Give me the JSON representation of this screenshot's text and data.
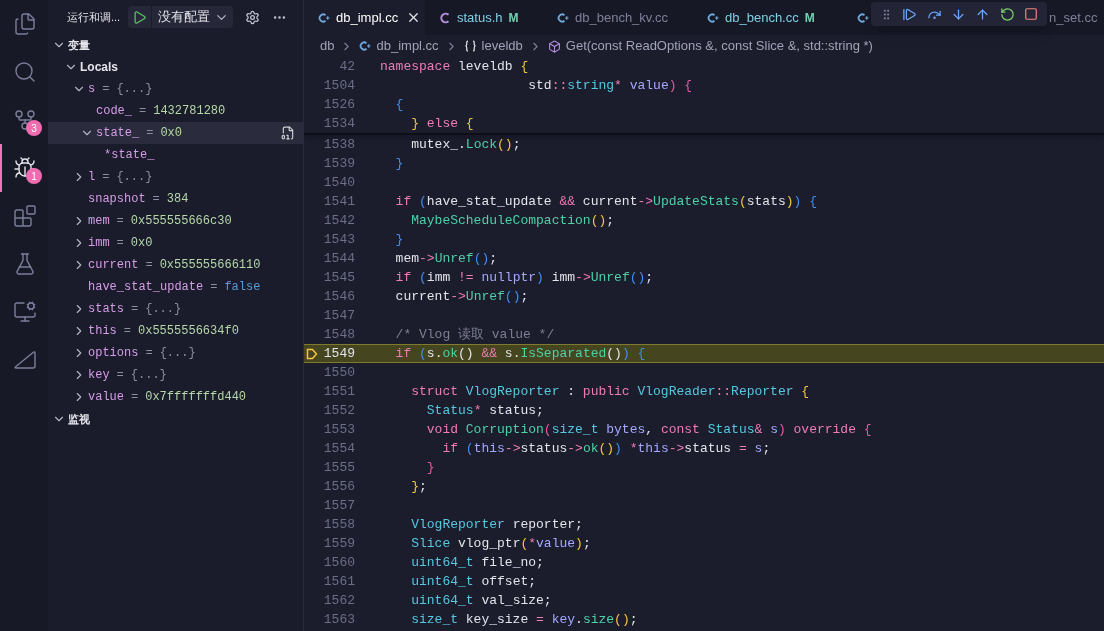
{
  "activity_bar": [
    {
      "selected": false
    },
    {
      "selected": false
    },
    {
      "selected": false,
      "badge": "3"
    },
    {
      "selected": true,
      "badge": "1"
    },
    {
      "selected": false
    },
    {
      "selected": false
    },
    {
      "selected": false
    },
    {
      "selected": false
    }
  ],
  "sidebar": {
    "title": "运行和调...",
    "config": "没有配置",
    "sections": [
      {
        "title": "变量",
        "expanded": true,
        "tree": [
          {
            "name": "Locals",
            "kind": "scope",
            "expanded": true,
            "selected": false,
            "children": [
              {
                "name": "s",
                "kind": "object",
                "eq": "=",
                "value": "{...}",
                "expanded": true,
                "selected": false,
                "children": [
                  {
                    "name": "code_",
                    "kind": "number",
                    "eq": "=",
                    "value": "1432781280",
                    "selected": false
                  },
                  {
                    "name": "state_",
                    "kind": "number",
                    "eq": "=",
                    "value": "0x0",
                    "expanded": true,
                    "selected": true,
                    "children": [
                      {
                        "name": "*state_",
                        "selected": false
                      }
                    ]
                  }
                ]
              },
              {
                "name": "l",
                "kind": "object",
                "eq": "=",
                "value": "{...}",
                "expanded": false,
                "selected": false
              },
              {
                "name": "snapshot",
                "kind": "number",
                "eq": "=",
                "value": "384",
                "selected": false
              },
              {
                "name": "mem",
                "kind": "number",
                "eq": "=",
                "value": "0x555555666c30",
                "expanded": false,
                "selected": false
              },
              {
                "name": "imm",
                "kind": "number",
                "eq": "=",
                "value": "0x0",
                "expanded": false,
                "selected": false
              },
              {
                "name": "current",
                "kind": "number",
                "eq": "=",
                "value": "0x555555666110",
                "expanded": false,
                "selected": false
              },
              {
                "name": "have_stat_update",
                "kind": "boolean",
                "eq": "=",
                "value": "false",
                "selected": false
              },
              {
                "name": "stats",
                "kind": "object",
                "eq": "=",
                "value": "{...}",
                "expanded": false,
                "selected": false
              },
              {
                "name": "this",
                "kind": "number",
                "eq": "=",
                "value": "0x5555556634f0",
                "expanded": false,
                "selected": false
              },
              {
                "name": "options",
                "kind": "object",
                "eq": "=",
                "value": "{...}",
                "expanded": false,
                "selected": false
              },
              {
                "name": "key",
                "kind": "object",
                "eq": "=",
                "value": "{...}",
                "expanded": false,
                "selected": false
              },
              {
                "name": "value",
                "kind": "number",
                "eq": "=",
                "value": "0x7fffffffd440",
                "expanded": false,
                "selected": false
              }
            ]
          }
        ]
      },
      {
        "title": "监视",
        "expanded": true
      }
    ]
  },
  "tabs": [
    {
      "label": "db_impl.cc",
      "selected": true
    },
    {
      "label": "status.h",
      "badge": "M",
      "selected": false
    },
    {
      "label": "db_bench_kv.cc",
      "selected": false
    },
    {
      "label": "db_bench.cc",
      "badge": "M",
      "selected": false
    },
    {
      "label": "n_set.cc",
      "selected": false
    }
  ],
  "breadcrumbs": [
    {
      "label": "db"
    },
    {
      "label": "db_impl.cc"
    },
    {
      "label": "leveldb"
    },
    {
      "label": "Get(const ReadOptions &, const Slice &, std::string *)"
    }
  ],
  "sticky_lines": [
    {
      "number": "42",
      "tokens": [
        {
          "kind": "kw",
          "text": "namespace"
        },
        {
          "kind": "plain",
          "text": " leveldb "
        },
        {
          "kind": "br1",
          "text": "{"
        }
      ]
    },
    {
      "number": "1504",
      "tokens": [
        {
          "kind": "plain",
          "text": "                   std"
        },
        {
          "kind": "op",
          "text": "::"
        },
        {
          "kind": "type",
          "text": "string"
        },
        {
          "kind": "op",
          "text": "*"
        },
        {
          "kind": "param",
          "text": " value"
        },
        {
          "kind": "br2",
          "text": ") {"
        }
      ]
    },
    {
      "number": "1526",
      "tokens": [
        {
          "kind": "br3",
          "text": "  {"
        }
      ]
    },
    {
      "number": "1534",
      "tokens": [
        {
          "kind": "br1",
          "text": "    }"
        },
        {
          "kind": "kw",
          "text": " else "
        },
        {
          "kind": "br1",
          "text": "{"
        }
      ]
    }
  ],
  "lines": [
    {
      "number": "1538",
      "current": false,
      "tokens": [
        {
          "kind": "plain",
          "text": "    mutex_."
        },
        {
          "kind": "fn",
          "text": "Lock"
        },
        {
          "kind": "br1",
          "text": "()"
        },
        {
          "kind": "plain",
          "text": ";"
        }
      ]
    },
    {
      "number": "1539",
      "current": false,
      "tokens": [
        {
          "kind": "br3",
          "text": "  }"
        }
      ]
    },
    {
      "number": "1540",
      "current": false
    },
    {
      "number": "1541",
      "current": false,
      "tokens": [
        {
          "kind": "kw",
          "text": "  if"
        },
        {
          "kind": "br3",
          "text": " ("
        },
        {
          "kind": "plain",
          "text": "have_stat_update "
        },
        {
          "kind": "op",
          "text": "&&"
        },
        {
          "kind": "plain",
          "text": " current"
        },
        {
          "kind": "op",
          "text": "->"
        },
        {
          "kind": "fn",
          "text": "UpdateStats"
        },
        {
          "kind": "br1",
          "text": "("
        },
        {
          "kind": "plain",
          "text": "stats"
        },
        {
          "kind": "br1",
          "text": ")"
        },
        {
          "kind": "br3",
          "text": ") {"
        }
      ]
    },
    {
      "number": "1542",
      "current": false,
      "tokens": [
        {
          "kind": "fn",
          "text": "    MaybeScheduleCompaction"
        },
        {
          "kind": "br1",
          "text": "()"
        },
        {
          "kind": "plain",
          "text": ";"
        }
      ]
    },
    {
      "number": "1543",
      "current": false,
      "tokens": [
        {
          "kind": "br3",
          "text": "  }"
        }
      ]
    },
    {
      "number": "1544",
      "current": false,
      "tokens": [
        {
          "kind": "plain",
          "text": "  mem"
        },
        {
          "kind": "op",
          "text": "->"
        },
        {
          "kind": "fn",
          "text": "Unref"
        },
        {
          "kind": "br3",
          "text": "()"
        },
        {
          "kind": "plain",
          "text": ";"
        }
      ]
    },
    {
      "number": "1545",
      "current": false,
      "tokens": [
        {
          "kind": "kw",
          "text": "  if"
        },
        {
          "kind": "br3",
          "text": " ("
        },
        {
          "kind": "plain",
          "text": "imm "
        },
        {
          "kind": "op",
          "text": "!="
        },
        {
          "kind": "param",
          "text": " nullptr"
        },
        {
          "kind": "br3",
          "text": ")"
        },
        {
          "kind": "plain",
          "text": " imm"
        },
        {
          "kind": "op",
          "text": "->"
        },
        {
          "kind": "fn",
          "text": "Unref"
        },
        {
          "kind": "br3",
          "text": "()"
        },
        {
          "kind": "plain",
          "text": ";"
        }
      ]
    },
    {
      "number": "1546",
      "current": false,
      "tokens": [
        {
          "kind": "plain",
          "text": "  current"
        },
        {
          "kind": "op",
          "text": "->"
        },
        {
          "kind": "fn",
          "text": "Unref"
        },
        {
          "kind": "br3",
          "text": "()"
        },
        {
          "kind": "plain",
          "text": ";"
        }
      ]
    },
    {
      "number": "1547",
      "current": false
    },
    {
      "number": "1548",
      "current": false,
      "tokens": [
        {
          "kind": "cm",
          "text": "  /* Vlog 读取 value */"
        }
      ]
    },
    {
      "number": "1549",
      "current": true,
      "tokens": [
        {
          "kind": "kw",
          "text": "  if"
        },
        {
          "kind": "br3",
          "text": " ("
        },
        {
          "kind": "plain",
          "text": "s."
        },
        {
          "kind": "fn",
          "text": "ok"
        },
        {
          "kind": "plain",
          "text": "() "
        },
        {
          "kind": "op",
          "text": "&&"
        },
        {
          "kind": "plain",
          "text": " s."
        },
        {
          "kind": "fn",
          "text": "IsSeparated"
        },
        {
          "kind": "plain",
          "text": "()"
        },
        {
          "kind": "br3",
          "text": ") {"
        }
      ]
    },
    {
      "number": "1550",
      "current": false
    },
    {
      "number": "1551",
      "current": false,
      "tokens": [
        {
          "kind": "kw",
          "text": "    struct"
        },
        {
          "kind": "type",
          "text": " VlogReporter"
        },
        {
          "kind": "plain",
          "text": " : "
        },
        {
          "kind": "kw",
          "text": "public"
        },
        {
          "kind": "type",
          "text": " VlogReader"
        },
        {
          "kind": "op",
          "text": "::"
        },
        {
          "kind": "type",
          "text": "Reporter"
        },
        {
          "kind": "br1",
          "text": " {"
        }
      ]
    },
    {
      "number": "1552",
      "current": false,
      "tokens": [
        {
          "kind": "type",
          "text": "      Status"
        },
        {
          "kind": "op",
          "text": "*"
        },
        {
          "kind": "plain",
          "text": " status;"
        }
      ]
    },
    {
      "number": "1553",
      "current": false,
      "tokens": [
        {
          "kind": "kw",
          "text": "      void"
        },
        {
          "kind": "fn",
          "text": " Corruption"
        },
        {
          "kind": "br2",
          "text": "("
        },
        {
          "kind": "type",
          "text": "size_t"
        },
        {
          "kind": "param",
          "text": " bytes"
        },
        {
          "kind": "plain",
          "text": ", "
        },
        {
          "kind": "kw",
          "text": "const"
        },
        {
          "kind": "type",
          "text": " Status"
        },
        {
          "kind": "op",
          "text": "&"
        },
        {
          "kind": "param",
          "text": " s"
        },
        {
          "kind": "br2",
          "text": ")"
        },
        {
          "kind": "kw",
          "text": " override"
        },
        {
          "kind": "br2",
          "text": " {"
        }
      ]
    },
    {
      "number": "1554",
      "current": false,
      "tokens": [
        {
          "kind": "kw",
          "text": "        if"
        },
        {
          "kind": "br3",
          "text": " ("
        },
        {
          "kind": "param",
          "text": "this"
        },
        {
          "kind": "op",
          "text": "->"
        },
        {
          "kind": "plain",
          "text": "status"
        },
        {
          "kind": "op",
          "text": "->"
        },
        {
          "kind": "fn",
          "text": "ok"
        },
        {
          "kind": "br1",
          "text": "()"
        },
        {
          "kind": "br3",
          "text": ")"
        },
        {
          "kind": "op",
          "text": " *"
        },
        {
          "kind": "param",
          "text": "this"
        },
        {
          "kind": "op",
          "text": "->"
        },
        {
          "kind": "plain",
          "text": "status "
        },
        {
          "kind": "op",
          "text": "="
        },
        {
          "kind": "param",
          "text": " s"
        },
        {
          "kind": "plain",
          "text": ";"
        }
      ]
    },
    {
      "number": "1555",
      "current": false,
      "tokens": [
        {
          "kind": "br2",
          "text": "      }"
        }
      ]
    },
    {
      "number": "1556",
      "current": false,
      "tokens": [
        {
          "kind": "br1",
          "text": "    }"
        },
        {
          "kind": "plain",
          "text": ";"
        }
      ]
    },
    {
      "number": "1557",
      "current": false
    },
    {
      "number": "1558",
      "current": false,
      "tokens": [
        {
          "kind": "type",
          "text": "    VlogReporter"
        },
        {
          "kind": "plain",
          "text": " reporter;"
        }
      ]
    },
    {
      "number": "1559",
      "current": false,
      "tokens": [
        {
          "kind": "type",
          "text": "    Slice"
        },
        {
          "kind": "plain",
          "text": " vlog_ptr"
        },
        {
          "kind": "br1",
          "text": "("
        },
        {
          "kind": "op",
          "text": "*"
        },
        {
          "kind": "param",
          "text": "value"
        },
        {
          "kind": "br1",
          "text": ")"
        },
        {
          "kind": "plain",
          "text": ";"
        }
      ]
    },
    {
      "number": "1560",
      "current": false,
      "tokens": [
        {
          "kind": "type",
          "text": "    uint64_t"
        },
        {
          "kind": "plain",
          "text": " file_no;"
        }
      ]
    },
    {
      "number": "1561",
      "current": false,
      "tokens": [
        {
          "kind": "type",
          "text": "    uint64_t"
        },
        {
          "kind": "plain",
          "text": " offset;"
        }
      ]
    },
    {
      "number": "1562",
      "current": false,
      "tokens": [
        {
          "kind": "type",
          "text": "    uint64_t"
        },
        {
          "kind": "plain",
          "text": " val_size;"
        }
      ]
    },
    {
      "number": "1563",
      "current": false,
      "tokens": [
        {
          "kind": "type",
          "text": "    size_t"
        },
        {
          "kind": "plain",
          "text": " key_size "
        },
        {
          "kind": "op",
          "text": "="
        },
        {
          "kind": "param",
          "text": " key"
        },
        {
          "kind": "plain",
          "text": "."
        },
        {
          "kind": "fn",
          "text": "size"
        },
        {
          "kind": "br1",
          "text": "()"
        },
        {
          "kind": "plain",
          "text": ";"
        }
      ]
    }
  ]
}
